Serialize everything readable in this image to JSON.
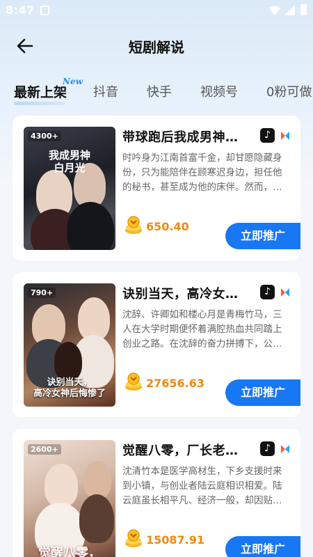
{
  "status_bar": {
    "time": "8:47"
  },
  "header": {
    "title": "短剧解说"
  },
  "tabs": [
    {
      "label": "最新上架",
      "active": true,
      "badge": "New"
    },
    {
      "label": "抖音"
    },
    {
      "label": "快手"
    },
    {
      "label": "视频号"
    },
    {
      "label": "0粉可做"
    }
  ],
  "dramas": [
    {
      "cover_play_count": "4300+",
      "cover_title": [
        "我成男神",
        "白月光"
      ],
      "title": "带球跑后我成男神…",
      "description": [
        "时吟身为江南首富千金，却甘愿隐藏身",
        "份，只为能陪伴在顾寒迟身边，担任他",
        "的秘书，甚至成为他的床伴。然而，…"
      ],
      "price": "650.40",
      "button": "立即推广"
    },
    {
      "cover_play_count": "790+",
      "cover_title": [
        "诀别当天，",
        "高冷女神后悔惨了"
      ],
      "title": "诀别当天，高冷女…",
      "description": [
        "沈辞、许卿如和楼心月是青梅竹马，三",
        "人在大学时期便怀着满腔热血共同踏上",
        "创业之路。在沈辞的奋力拼搏下，公…"
      ],
      "price": "27656.63",
      "button": "立即推广"
    },
    {
      "cover_play_count": "2600+",
      "cover_title": [
        "觉醒八零，"
      ],
      "title": "觉醒八零，厂长老…",
      "description": [
        "沈清竹本是医学高材生，下乡支援时来",
        "到小镇，与创业者陆云庭相识相爱。陆",
        "云庭虽长相平凡、经济一般，却因贴…"
      ],
      "price": "15087.91",
      "button": "立即推广"
    }
  ],
  "colors": {
    "accent": "#1877f2",
    "price": "#f08a10",
    "new_badge": "#2c8cf0"
  }
}
